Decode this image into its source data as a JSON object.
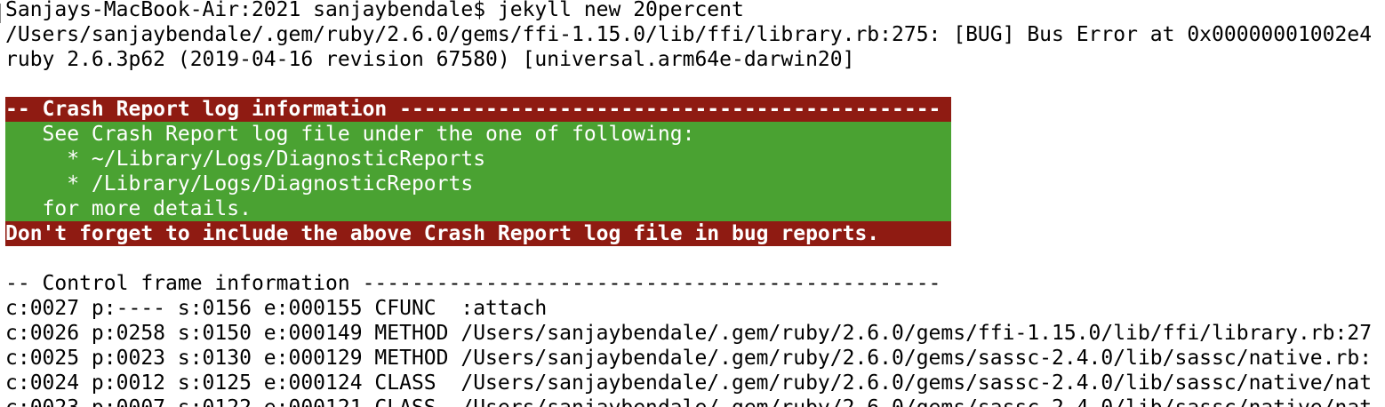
{
  "terminal": {
    "lines": [
      "Sanjays-MacBook-Air:2021 sanjaybendale$ jekyll new 20percent",
      "/Users/sanjaybendale/.gem/ruby/2.6.0/gems/ffi-1.15.0/lib/ffi/library.rb:275: [BUG] Bus Error at 0x00000001002e4",
      "ruby 2.6.3p62 (2019-04-16 revision 67580) [universal.arm64e-darwin20]",
      "-- Crash Report log information --------------------------------------------",
      "   See Crash Report log file under the one of following:",
      "     * ~/Library/Logs/DiagnosticReports",
      "     * /Library/Logs/DiagnosticReports",
      "   for more details.",
      "Don't forget to include the above Crash Report log file in bug reports.",
      "-- Control frame information -----------------------------------------------",
      "c:0027 p:---- s:0156 e:000155 CFUNC  :attach",
      "c:0026 p:0258 s:0150 e:000149 METHOD /Users/sanjaybendale/.gem/ruby/2.6.0/gems/ffi-1.15.0/lib/ffi/library.rb:27",
      "c:0025 p:0023 s:0130 e:000129 METHOD /Users/sanjaybendale/.gem/ruby/2.6.0/gems/sassc-2.4.0/lib/sassc/native.rb:",
      "c:0024 p:0012 s:0125 e:000124 CLASS  /Users/sanjaybendale/.gem/ruby/2.6.0/gems/sassc-2.4.0/lib/sassc/native/nat",
      "c:0023 p:0007 s:0122 e:000121 CLASS  /Users/sanjaybendale/.gem/ruby/2.6.0/gems/sassc-2.4.0/lib/sassc/native/nat"
    ]
  },
  "colors": {
    "banner_red": "#8f1b12",
    "banner_green": "#4aa232",
    "text": "#000000",
    "background": "#ffffff"
  }
}
